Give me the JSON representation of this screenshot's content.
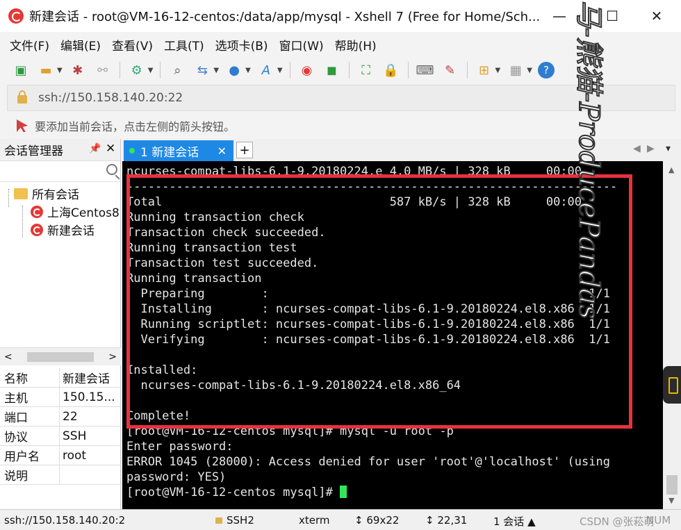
{
  "window": {
    "title": "新建会话 - root@VM-16-12-centos:/data/app/mysql - Xshell 7 (Free for Home/Sch...",
    "minimize": "—",
    "maximize": "☐",
    "close": "✕"
  },
  "menu": [
    "文件(F)",
    "编辑(E)",
    "查看(V)",
    "工具(T)",
    "选项卡(B)",
    "窗口(W)",
    "帮助(H)"
  ],
  "address": {
    "text": "ssh://150.158.140.20:22"
  },
  "hint": {
    "text": "要添加当前会话，点击左侧的箭头按钮。"
  },
  "session_manager": {
    "title": "会话管理器",
    "pin": "📌",
    "close": "✕",
    "tree": {
      "root": "所有会话",
      "children": [
        "上海Centos8",
        "新建会话"
      ]
    },
    "hscroll_left": "<",
    "hscroll_right": ">",
    "properties": [
      {
        "key": "名称",
        "value": "新建会话"
      },
      {
        "key": "主机",
        "value": "150.15..."
      },
      {
        "key": "端口",
        "value": "22"
      },
      {
        "key": "协议",
        "value": "SSH"
      },
      {
        "key": "用户名",
        "value": "root"
      },
      {
        "key": "说明",
        "value": ""
      }
    ]
  },
  "tab": {
    "label": "1 新建会话",
    "close": "✕",
    "new": "+",
    "nav_left": "◀",
    "nav_right": "▶",
    "nav_menu": "▾"
  },
  "terminal": {
    "lines": [
      "ncurses-compat-libs-6.1-9.20180224.e 4.0 MB/s | 328 kB     00:00",
      "---------------------------------------------------------------------",
      "Total                                587 kB/s | 328 kB     00:00",
      "Running transaction check",
      "Transaction check succeeded.",
      "Running transaction test",
      "Transaction test succeeded.",
      "Running transaction",
      "  Preparing        :                                             1/1",
      "  Installing       : ncurses-compat-libs-6.1-9.20180224.el8.x86  1/1",
      "  Running scriptlet: ncurses-compat-libs-6.1-9.20180224.el8.x86  1/1",
      "  Verifying        : ncurses-compat-libs-6.1-9.20180224.el8.x86  1/1",
      "",
      "Installed:",
      "  ncurses-compat-libs-6.1-9.20180224.el8.x86_64",
      "",
      "Complete!",
      "[root@VM-16-12-centos mysql]# mysql -u root -p",
      "Enter password:",
      "ERROR 1045 (28000): Access denied for user 'root'@'localhost' (using",
      "password: YES)"
    ],
    "prompt": "[root@VM-16-12-centos mysql]# "
  },
  "status": {
    "address": "ssh://150.158.140.20:2",
    "protocol": "SSH2",
    "term": "xterm",
    "size": "69x22",
    "size_icon": "↕",
    "cursor": "22,31",
    "cursor_icon": "↕",
    "sessions": "1 会话",
    "sessions_arrow": "▲",
    "watermark_csdn": "CSDN @张菘萌",
    "num": "NUM"
  },
  "overlay": {
    "watermark": "马-熊猫-ProducePandas"
  },
  "colors": {
    "tab_active": "#1e88e5",
    "highlight": "#e8323a",
    "cursor": "#2ee85a",
    "terminal_bg": "#000000"
  }
}
